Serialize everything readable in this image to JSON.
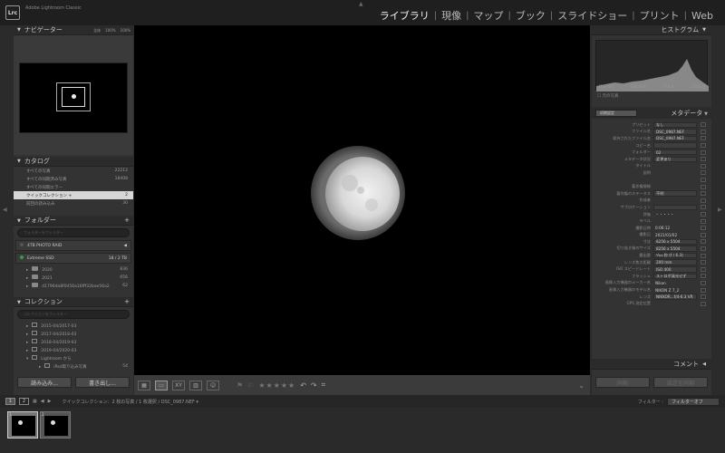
{
  "app": {
    "logo": "Lrc",
    "title": "Adobe Lightroom Classic"
  },
  "modules": [
    "ライブラリ",
    "現像",
    "マップ",
    "ブック",
    "スライドショー",
    "プリント",
    "Web"
  ],
  "navigator": {
    "title": "ナビゲーター",
    "zoom": [
      "全体",
      "100%",
      "100%"
    ]
  },
  "catalog": {
    "title": "カタログ",
    "items": [
      {
        "label": "すべての写真",
        "count": "22212"
      },
      {
        "label": "すべての同期済み写真",
        "count": "18408"
      },
      {
        "label": "すべての同期エラー",
        "count": ""
      },
      {
        "label": "クイックコレクション +",
        "count": "2"
      },
      {
        "label": "前回の読み込み",
        "count": "30"
      }
    ]
  },
  "folders": {
    "title": "フォルダー",
    "search_placeholder": "フォルダーをフィルター",
    "volumes": [
      {
        "name": "4TB PHOTO RAID",
        "info": "◀"
      },
      {
        "name": "Extreme SSD",
        "info": "18 / 2 TB"
      }
    ],
    "items": [
      {
        "name": "2020",
        "count": "836"
      },
      {
        "name": "2021",
        "count": "656"
      },
      {
        "name": "d1796da8f0d56a16fff32bae56a2",
        "count": "62"
      }
    ]
  },
  "collections": {
    "title": "コレクション",
    "search_placeholder": "コレクションをフィルター",
    "items": [
      "2015-04/2017-03",
      "2017-04/2018-03",
      "2018-04/2019-03",
      "2019-04/2020-03",
      "Lightroom から",
      "iPad取り込み写真"
    ],
    "last_count": "54"
  },
  "left_buttons": {
    "import": "読み込み...",
    "export": "書き出し..."
  },
  "histogram": {
    "title": "ヒストグラム",
    "iso": "ISO 400",
    "focal": "200 mm",
    "aperture": "f / 6.3",
    "shutter": "1/320 秒",
    "original": "元の写真"
  },
  "metadata": {
    "title": "メタデータ",
    "preset_select": "初期設定",
    "rows": [
      {
        "k": "プリセット",
        "v": "なし"
      },
      {
        "k": "ファイル名",
        "v": "DSC_0987.NEF"
      },
      {
        "k": "保持されたファイル名",
        "v": "DSC_0987.NEF"
      },
      {
        "k": "コピー名",
        "v": ""
      },
      {
        "k": "フォルダー",
        "v": "02"
      },
      {
        "k": "メタデータ状況",
        "v": "変更あり"
      },
      {
        "k": "タイトル",
        "v": ""
      },
      {
        "k": "説明",
        "v": ""
      },
      {
        "k": "",
        "v": ""
      },
      {
        "k": "著作権情報",
        "v": ""
      },
      {
        "k": "著作権のステータス",
        "v": "不明"
      },
      {
        "k": "作成者",
        "v": ""
      },
      {
        "k": "サブロケーション",
        "v": ""
      },
      {
        "k": "評価",
        "v": "・・・・・"
      },
      {
        "k": "ラベル",
        "v": ""
      },
      {
        "k": "撮影日時",
        "v": "0:06:12"
      },
      {
        "k": "撮影日",
        "v": "2021/01/02"
      },
      {
        "k": "寸法",
        "v": "8256 x 5504"
      },
      {
        "k": "切り抜き後のサイズ",
        "v": "8256 x 5504"
      },
      {
        "k": "露出量",
        "v": "¹⁄₃₂₀ 秒 (f / 6.3)"
      },
      {
        "k": "レンズ焦点距離",
        "v": "200 mm"
      },
      {
        "k": "ISO スピードレート",
        "v": "ISO 400"
      },
      {
        "k": "フラッシュ",
        "v": "ストロボ発光せず"
      },
      {
        "k": "画像入力機器のメーカー名",
        "v": "Nikon"
      },
      {
        "k": "画像入力機器のモデル名",
        "v": "NIKON Z 7_2"
      },
      {
        "k": "レンズ",
        "v": "NIKKOR...f/4-6.3 VR"
      },
      {
        "k": "GPS 測定位置",
        "v": ""
      }
    ]
  },
  "comments": {
    "title": "コメント"
  },
  "right_buttons": {
    "sync": "同期",
    "sync_settings": "設定を同期"
  },
  "filmstrip_bar": {
    "pages": [
      "1",
      "2"
    ],
    "source": "クイックコレクション：2 枚の写真 / 1 枚選択 / DSC_0987.NEF ▾",
    "filter_label": "フィルター :",
    "filter_value": "フィルターオフ"
  },
  "thumbs": [
    {
      "badge": "1"
    },
    {
      "badge": "2"
    }
  ]
}
